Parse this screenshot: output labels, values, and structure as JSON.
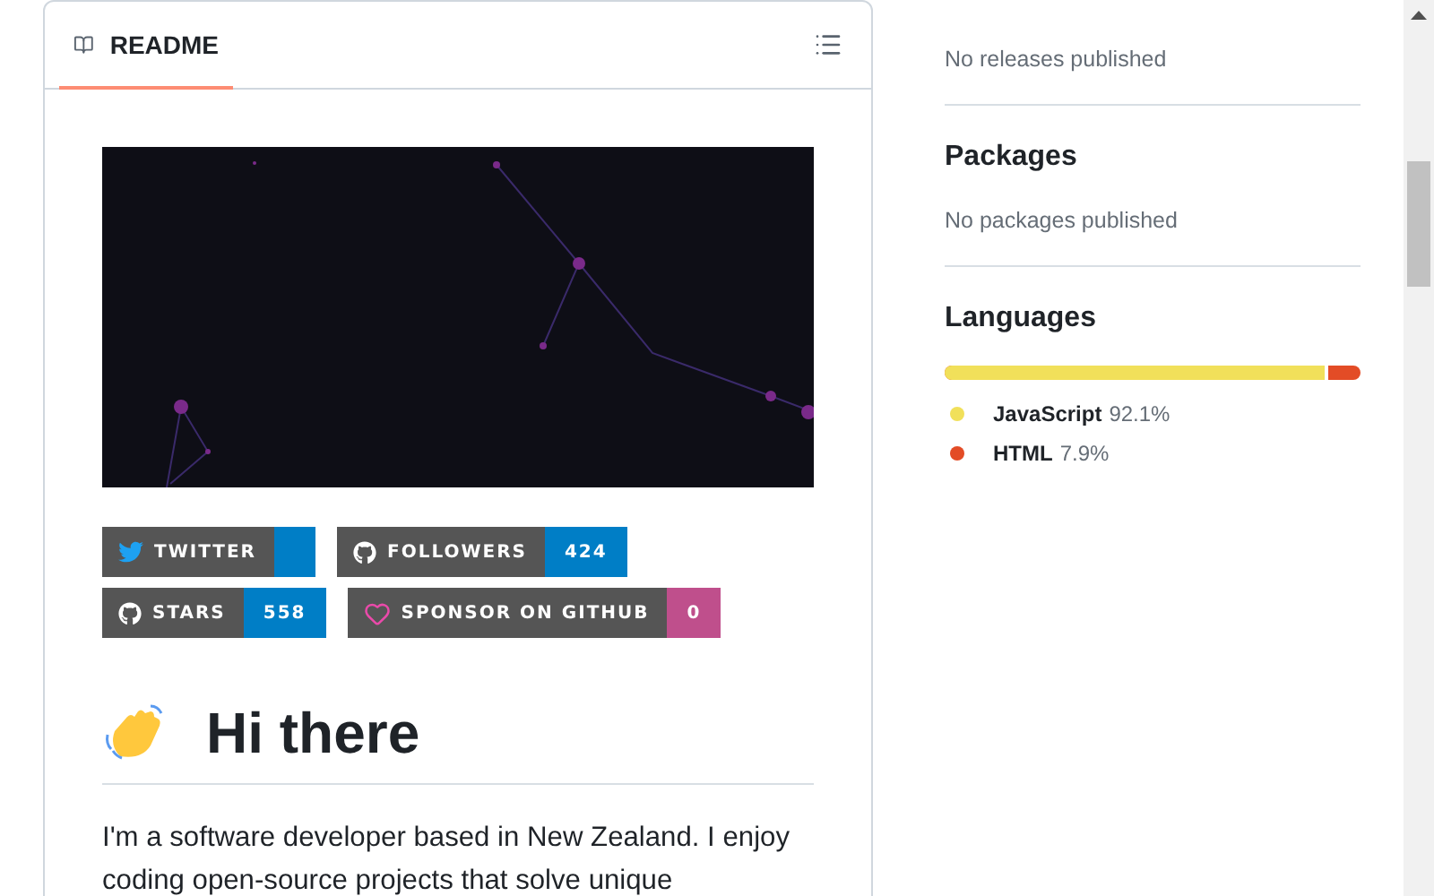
{
  "readme": {
    "tab": {
      "label": "README",
      "selected": true
    },
    "badges": [
      {
        "kind": "twitter",
        "label": "TWITTER",
        "color": "#007ec6"
      },
      {
        "kind": "github",
        "label": "FOLLOWERS",
        "value": "424",
        "color": "#007ec6"
      },
      {
        "kind": "github",
        "label": "STARS",
        "value": "558",
        "color": "#007ec6"
      },
      {
        "kind": "sponsor",
        "label": "SPONSOR ON GITHUB",
        "value": "0",
        "color": "#bf4f8c"
      }
    ],
    "heading": "Hi there",
    "paragraph": "I'm a software developer based in New Zealand. I enjoy coding open-source projects that solve unique"
  },
  "sidebar": {
    "sections": [
      {
        "text": "No releases published"
      },
      {
        "title": "Packages",
        "text": "No packages published"
      }
    ],
    "languages": {
      "title": "Languages",
      "items": [
        {
          "name": "JavaScript",
          "percent": "92.1%",
          "color": "#f1e05a"
        },
        {
          "name": "HTML",
          "percent": "7.9%",
          "color": "#e34c26"
        }
      ],
      "bar": {
        "level": 0.921
      }
    }
  }
}
